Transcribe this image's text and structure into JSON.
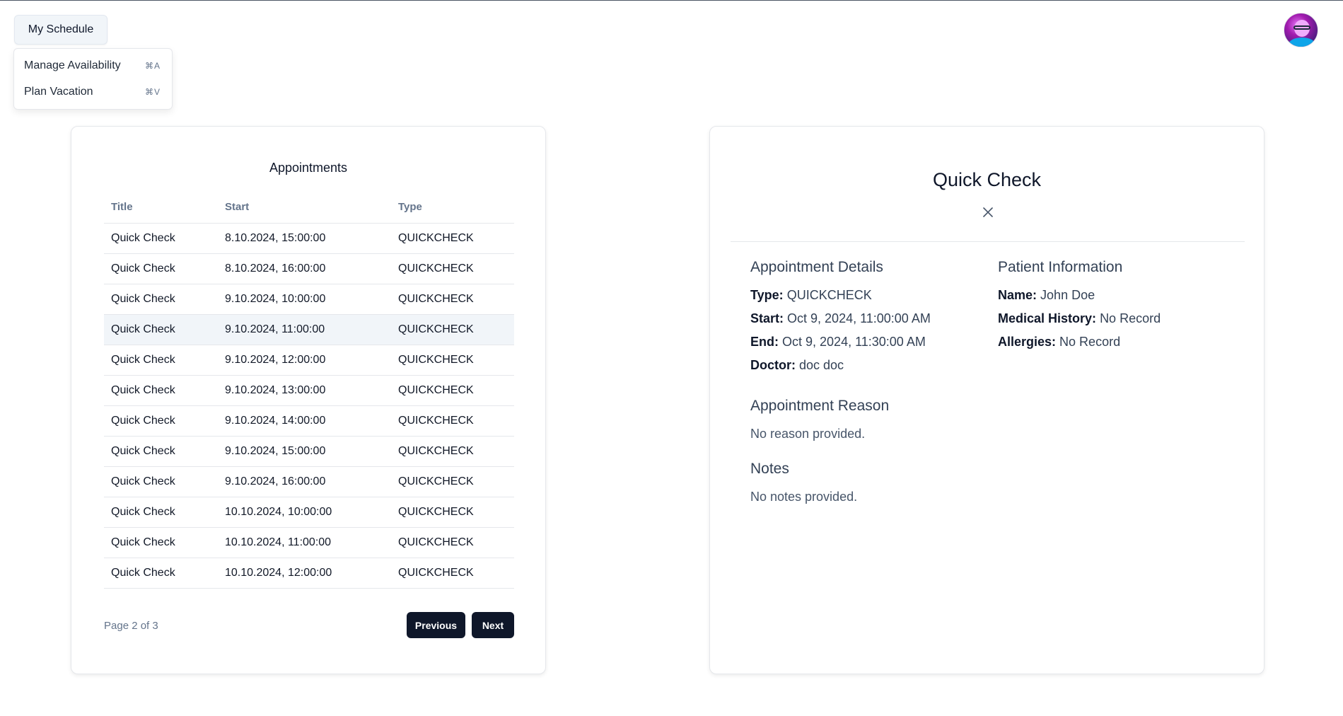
{
  "menu": {
    "trigger_label": "My Schedule",
    "items": [
      {
        "label": "Manage Availability",
        "shortcut": "⌘A"
      },
      {
        "label": "Plan Vacation",
        "shortcut": "⌘V"
      }
    ]
  },
  "appointments": {
    "title": "Appointments",
    "columns": [
      "Title",
      "Start",
      "Type"
    ],
    "rows": [
      {
        "title": "Quick Check",
        "start": "8.10.2024, 15:00:00",
        "type": "QUICKCHECK"
      },
      {
        "title": "Quick Check",
        "start": "8.10.2024, 16:00:00",
        "type": "QUICKCHECK"
      },
      {
        "title": "Quick Check",
        "start": "9.10.2024, 10:00:00",
        "type": "QUICKCHECK"
      },
      {
        "title": "Quick Check",
        "start": "9.10.2024, 11:00:00",
        "type": "QUICKCHECK"
      },
      {
        "title": "Quick Check",
        "start": "9.10.2024, 12:00:00",
        "type": "QUICKCHECK"
      },
      {
        "title": "Quick Check",
        "start": "9.10.2024, 13:00:00",
        "type": "QUICKCHECK"
      },
      {
        "title": "Quick Check",
        "start": "9.10.2024, 14:00:00",
        "type": "QUICKCHECK"
      },
      {
        "title": "Quick Check",
        "start": "9.10.2024, 15:00:00",
        "type": "QUICKCHECK"
      },
      {
        "title": "Quick Check",
        "start": "9.10.2024, 16:00:00",
        "type": "QUICKCHECK"
      },
      {
        "title": "Quick Check",
        "start": "10.10.2024, 10:00:00",
        "type": "QUICKCHECK"
      },
      {
        "title": "Quick Check",
        "start": "10.10.2024, 11:00:00",
        "type": "QUICKCHECK"
      },
      {
        "title": "Quick Check",
        "start": "10.10.2024, 12:00:00",
        "type": "QUICKCHECK"
      }
    ],
    "selected_row_index": 3,
    "page_info": "Page 2 of 3",
    "previous_label": "Previous",
    "next_label": "Next"
  },
  "details": {
    "title": "Quick Check",
    "close_icon": "close-icon",
    "appointment_details": {
      "heading": "Appointment Details",
      "type_label": "Type:",
      "type_value": "QUICKCHECK",
      "start_label": "Start:",
      "start_value": "Oct 9, 2024, 11:00:00 AM",
      "end_label": "End:",
      "end_value": "Oct 9, 2024, 11:30:00 AM",
      "doctor_label": "Doctor:",
      "doctor_value": "doc doc"
    },
    "patient_information": {
      "heading": "Patient Information",
      "name_label": "Name:",
      "name_value": "John Doe",
      "history_label": "Medical History:",
      "history_value": "No Record",
      "allergies_label": "Allergies:",
      "allergies_value": "No Record"
    },
    "reason": {
      "heading": "Appointment Reason",
      "text": "No reason provided."
    },
    "notes": {
      "heading": "Notes",
      "text": "No notes provided."
    }
  },
  "colors": {
    "primary": "#0f172a",
    "muted": "#64748b",
    "selected_row": "#f1f5f9"
  }
}
